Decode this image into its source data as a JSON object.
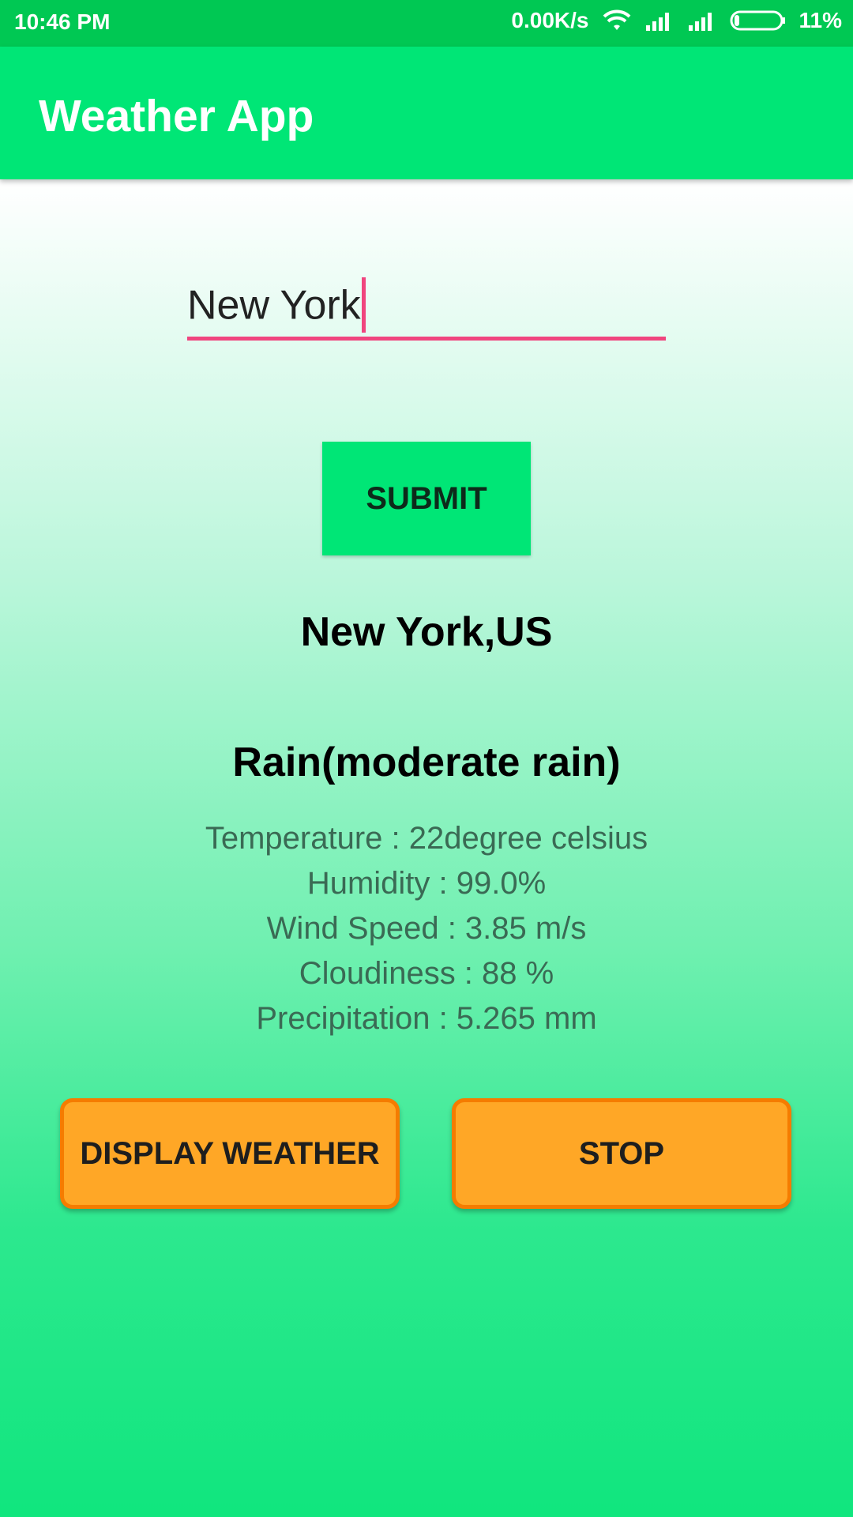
{
  "status_bar": {
    "time": "10:46 PM",
    "speed": "0.00K/s",
    "battery": "11%",
    "icons": [
      "wifi-icon",
      "signal-icon",
      "signal-icon",
      "battery-icon"
    ]
  },
  "app_bar": {
    "title": "Weather App"
  },
  "city_input": {
    "value": "New York"
  },
  "submit_label": "SUBMIT",
  "location": "New York,US",
  "condition": "Rain(moderate rain)",
  "details": {
    "temperature": "Temperature : 22degree celsius",
    "humidity": "Humidity : 99.0%",
    "wind_speed": "Wind Speed : 3.85 m/s",
    "cloudiness": "Cloudiness : 88 %",
    "precipitation": "Precipitation : 5.265 mm"
  },
  "buttons": {
    "display_weather": "DISPLAY WEATHER",
    "stop": "STOP"
  },
  "colors": {
    "status_bar": "#00c853",
    "app_bar": "#00e676",
    "accent": "#f0457e",
    "orange_button": "#ffa726",
    "orange_border": "#f57c00"
  }
}
